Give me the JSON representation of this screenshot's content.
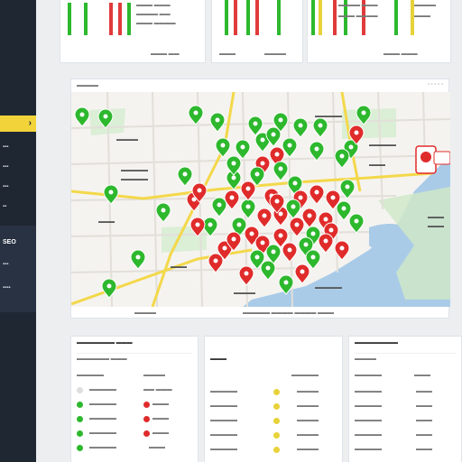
{
  "sidebar": {
    "active_chevron": "›",
    "items": [
      {
        "label": "",
        "icon": "menu-icon"
      },
      {
        "label": "SEO"
      }
    ]
  },
  "top_cards": {
    "card_a": {
      "bar_colors": [
        "#2db82d",
        "#e03b3b",
        "#2db82d",
        "#e03b3b"
      ]
    },
    "card_b": {
      "bar_colors": [
        "#2db82d",
        "#e03b3b",
        "#2db82d"
      ]
    },
    "card_c": {
      "bar_colors": [
        "#2db82d",
        "#e8d23a",
        "#e03b3b",
        "#2db82d"
      ]
    }
  },
  "map": {
    "header": "",
    "footer": "",
    "colors": {
      "water": "#a9cbe8",
      "park": "#cfe8c8",
      "road": "#f3d84a",
      "pin_green": "#2db82d",
      "pin_red": "#e02b2b"
    }
  },
  "panels": {
    "left": {
      "title": "",
      "plus_icon": "+"
    },
    "middle": {
      "title": ""
    },
    "right": {
      "title": ""
    }
  },
  "colors": {
    "sidebar": "#1f2733",
    "accent": "#f2d43a",
    "green": "#2db82d",
    "red": "#e02b2b",
    "yellow": "#e8d23a"
  }
}
